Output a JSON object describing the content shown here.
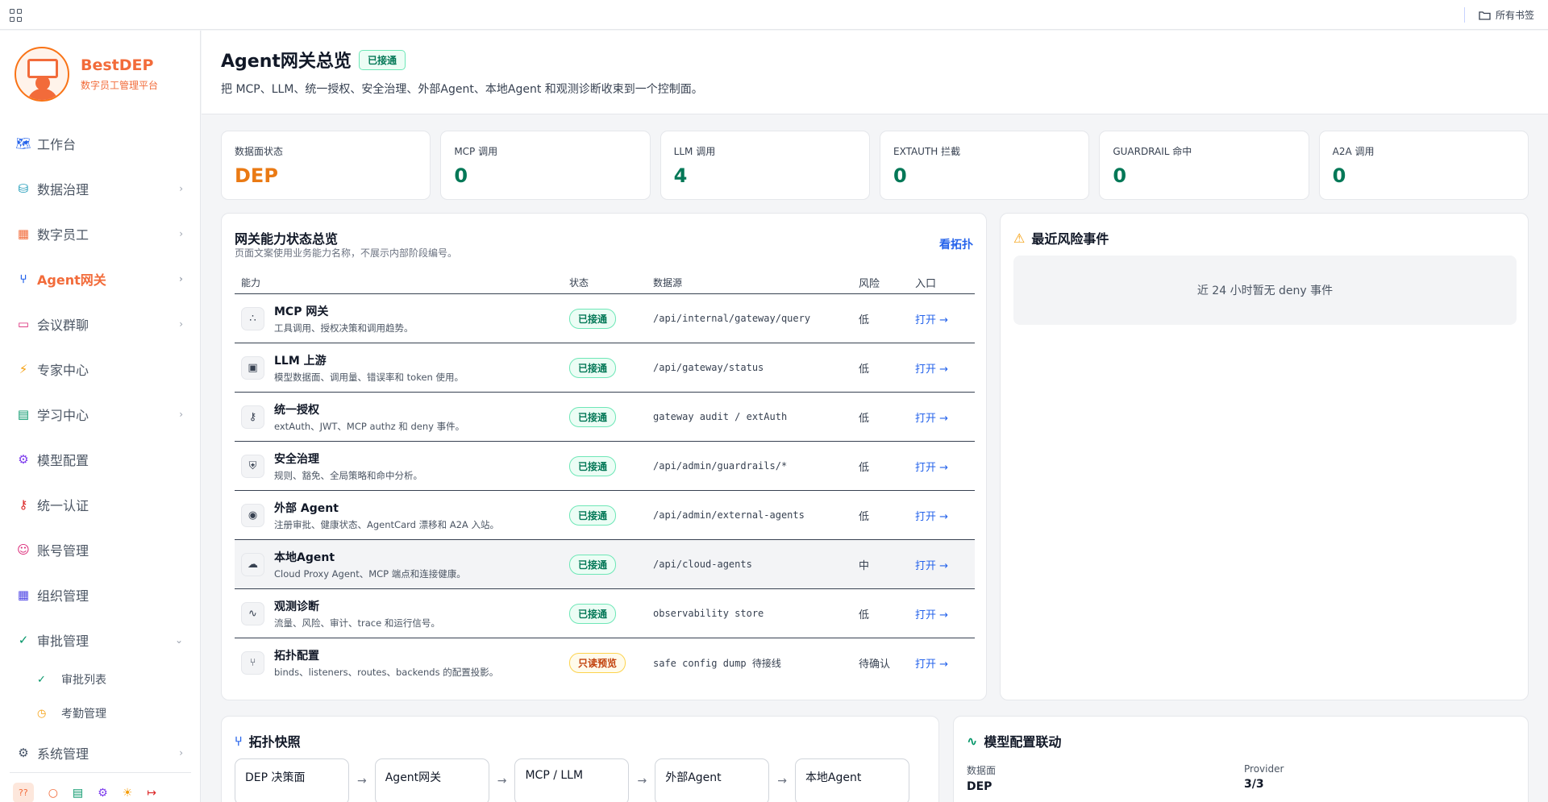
{
  "topbar": {
    "bookmarks_label": "所有书签"
  },
  "brand": {
    "name": "BestDEP",
    "subtitle": "数字员工管理平台"
  },
  "nav": {
    "workbench": "工作台",
    "data_governance": "数据治理",
    "digital_staff": "数字员工",
    "agent_gateway": "Agent网关",
    "meeting_chat": "会议群聊",
    "expert_center": "专家中心",
    "learning_center": "学习中心",
    "model_config": "模型配置",
    "unified_auth": "统一认证",
    "account_mgmt": "账号管理",
    "org_mgmt": "组织管理",
    "approval_mgmt": "审批管理",
    "approval_list": "审批列表",
    "attendance_mgmt": "考勤管理",
    "system_mgmt": "系统管理",
    "help_badge": "??"
  },
  "header": {
    "title": "Agent网关总览",
    "badge": "已接通",
    "description": "把 MCP、LLM、统一授权、安全治理、外部Agent、本地Agent 和观测诊断收束到一个控制面。"
  },
  "stats": [
    {
      "label": "数据面状态",
      "value": "DEP"
    },
    {
      "label": "MCP 调用",
      "value": "0"
    },
    {
      "label": "LLM 调用",
      "value": "4"
    },
    {
      "label": "EXTAUTH 拦截",
      "value": "0"
    },
    {
      "label": "GUARDRAIL 命中",
      "value": "0"
    },
    {
      "label": "A2A 调用",
      "value": "0"
    }
  ],
  "capabilities": {
    "title": "网关能力状态总览",
    "subtitle": "页面文案使用业务能力名称，不展示内部阶段编号。",
    "topology_link": "看拓扑",
    "columns": [
      "能力",
      "状态",
      "数据源",
      "风险",
      "入口"
    ],
    "rows": [
      {
        "name": "MCP 网关",
        "desc": "工具调用、授权决策和调用趋势。",
        "status": "已接通",
        "source": "/api/internal/gateway/query",
        "risk": "低",
        "entry": "打开 →"
      },
      {
        "name": "LLM 上游",
        "desc": "模型数据面、调用量、错误率和 token 使用。",
        "status": "已接通",
        "source": "/api/gateway/status",
        "risk": "低",
        "entry": "打开 →"
      },
      {
        "name": "统一授权",
        "desc": "extAuth、JWT、MCP authz 和 deny 事件。",
        "status": "已接通",
        "source": "gateway audit / extAuth",
        "risk": "低",
        "entry": "打开 →"
      },
      {
        "name": "安全治理",
        "desc": "规则、豁免、全局策略和命中分析。",
        "status": "已接通",
        "source": "/api/admin/guardrails/*",
        "risk": "低",
        "entry": "打开 →"
      },
      {
        "name": "外部 Agent",
        "desc": "注册审批、健康状态、AgentCard 漂移和 A2A 入站。",
        "status": "已接通",
        "source": "/api/admin/external-agents",
        "risk": "低",
        "entry": "打开 →"
      },
      {
        "name": "本地Agent",
        "desc": "Cloud Proxy Agent、MCP 端点和连接健康。",
        "status": "已接通",
        "source": "/api/cloud-agents",
        "risk": "中",
        "entry": "打开 →"
      },
      {
        "name": "观测诊断",
        "desc": "流量、风险、审计、trace 和运行信号。",
        "status": "已接通",
        "source": "observability store",
        "risk": "低",
        "entry": "打开 →"
      },
      {
        "name": "拓扑配置",
        "desc": "binds、listeners、routes、backends 的配置投影。",
        "status": "只读预览",
        "source": "safe config dump 待接线",
        "risk": "待确认",
        "entry": "打开 →"
      }
    ]
  },
  "risk": {
    "title": "最近风险事件",
    "empty": "近 24 小时暂无 deny 事件"
  },
  "topology": {
    "title": "拓扑快照",
    "nodes": [
      "DEP 决策面",
      "Agent网关",
      "MCP / LLM",
      "外部Agent",
      "本地Agent"
    ]
  },
  "model_config": {
    "title": "模型配置联动",
    "data_plane_label": "数据面",
    "data_plane_value": "DEP",
    "provider_label": "Provider",
    "provider_value": "3/3"
  },
  "colors": {
    "brand": "#f26b3a",
    "ok": "#047857",
    "link": "#2563eb",
    "warn": "#c2410c"
  }
}
